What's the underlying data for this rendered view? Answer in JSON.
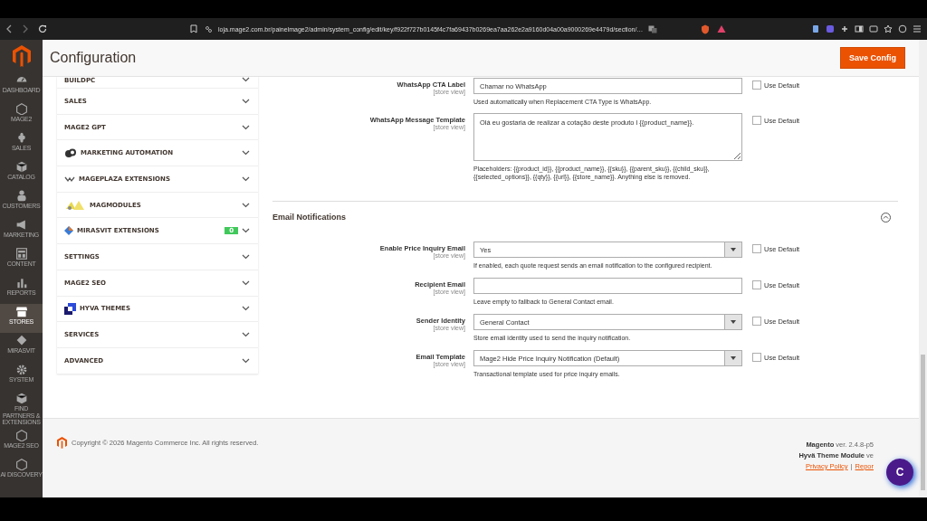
{
  "browser": {
    "url": "loja.mage2.com.br/painelmage2/admin/system_config/edit/key/f922f727b0145f4c7fa69437b0269ea7aa262e2a9160d04a00a9000269e4479d/section/…"
  },
  "sidebar": {
    "items": [
      {
        "label": "DASHBOARD",
        "selected": false
      },
      {
        "label": "MAGE2",
        "selected": false
      },
      {
        "label": "SALES",
        "selected": false
      },
      {
        "label": "CATALOG",
        "selected": false
      },
      {
        "label": "CUSTOMERS",
        "selected": false
      },
      {
        "label": "MARKETING",
        "selected": false
      },
      {
        "label": "CONTENT",
        "selected": false
      },
      {
        "label": "REPORTS",
        "selected": false
      },
      {
        "label": "STORES",
        "selected": true
      },
      {
        "label": "MIRASVIT",
        "selected": false
      },
      {
        "label": "SYSTEM",
        "selected": false
      },
      {
        "label": "FIND PARTNERS & EXTENSIONS",
        "selected": false
      },
      {
        "label": "MAGE2 SEO",
        "selected": false
      },
      {
        "label": "AI DISCOVERY",
        "selected": false
      }
    ]
  },
  "header": {
    "title": "Configuration",
    "save_button": "Save Config"
  },
  "config_tabs": [
    {
      "label": "BUILDPC",
      "kind": "plain"
    },
    {
      "label": "SALES",
      "kind": "plain"
    },
    {
      "label": "MAGE2 GPT",
      "kind": "plain"
    },
    {
      "label": "MARKETING AUTOMATION",
      "kind": "logo"
    },
    {
      "label": "MAGEPLAZA EXTENSIONS",
      "kind": "logo"
    },
    {
      "label": "MAGMODULES",
      "kind": "logo"
    },
    {
      "label": "MIRASVIT EXTENSIONS",
      "kind": "logo",
      "badge": "0"
    },
    {
      "label": "SETTINGS",
      "kind": "plain"
    },
    {
      "label": "MAGE2 SEO",
      "kind": "plain"
    },
    {
      "label": "HYVA THEMES",
      "kind": "logo"
    },
    {
      "label": "SERVICES",
      "kind": "plain"
    },
    {
      "label": "ADVANCED",
      "kind": "plain"
    }
  ],
  "whatsapp_fields": [
    {
      "kind": "text",
      "label": "WhatsApp CTA Label",
      "scope": "[store view]",
      "value": "Chamar no WhatsApp",
      "note": "Used automatically when Replacement CTA Type is WhatsApp.",
      "use_default": {
        "label": "Use Default",
        "checked": false
      }
    },
    {
      "kind": "textarea",
      "label": "WhatsApp Message Template",
      "scope": "[store view]",
      "value": "Olá eu gostaria de realizar a cotação deste produto l {{product_name}}.",
      "note": "Placeholders: {{product_id}}, {{product_name}}, {{sku}}, {{parent_sku}}, {{child_sku}}, {{selected_options}}, {{qty}}, {{url}}, {{store_name}}. Anything else is removed.",
      "use_default": {
        "label": "Use Default",
        "checked": false
      }
    }
  ],
  "email_section": {
    "title": "Email Notifications",
    "expanded": true,
    "fields": [
      {
        "kind": "select",
        "label": "Enable Price Inquiry Email",
        "scope": "[store view]",
        "value": "Yes",
        "note": "If enabled, each quote request sends an email notification to the configured recipient.",
        "use_default": {
          "label": "Use Default",
          "checked": false
        }
      },
      {
        "kind": "text",
        "label": "Recipient Email",
        "scope": "[store view]",
        "note": "Leave empty to fallback to General Contact email.",
        "use_default": {
          "label": "Use Default",
          "checked": false
        }
      },
      {
        "kind": "select",
        "label": "Sender Identity",
        "scope": "[store view]",
        "value": "General Contact",
        "note": "Store email identity used to send the inquiry notification.",
        "use_default": {
          "label": "Use Default",
          "checked": false
        }
      },
      {
        "kind": "select",
        "label": "Email Template",
        "scope": "[store view]",
        "value": "Mage2 Hide Price Inquiry Notification (Default)",
        "note": "Transactional template used for price inquiry emails.",
        "use_default": {
          "label": "Use Default",
          "checked": false
        }
      }
    ]
  },
  "footer": {
    "copyright": "Copyright © 2026 Magento Commerce Inc. All rights reserved.",
    "versions": [
      "**Magento** ver. 2.4.8-p5",
      "**Hyvä Theme Module** ve"
    ],
    "links": [
      "Privacy Policy",
      "Repor"
    ],
    "separator": "|",
    "chat_button": "C"
  }
}
